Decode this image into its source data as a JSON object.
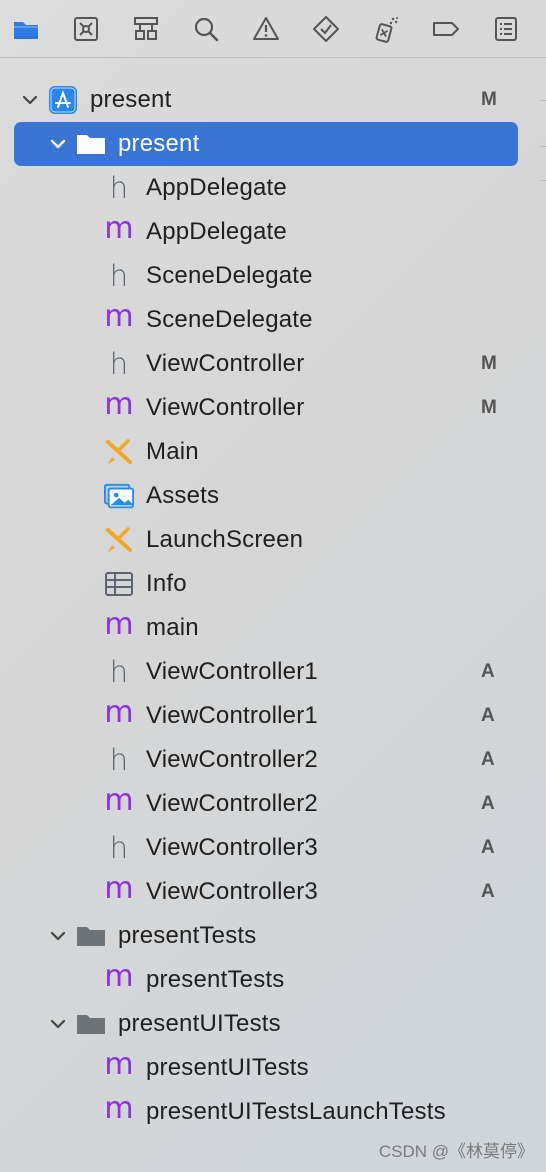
{
  "toolbar": {
    "icons": [
      "folder-icon",
      "source-control-icon",
      "hierarchy-icon",
      "search-icon",
      "warning-icon",
      "test-icon",
      "debug-icon",
      "breakpoint-icon",
      "report-icon"
    ]
  },
  "project": {
    "name": "present",
    "badge": "M"
  },
  "group_main": {
    "name": "present"
  },
  "files": [
    {
      "name": "AppDelegate",
      "kind": "h",
      "badge": ""
    },
    {
      "name": "AppDelegate",
      "kind": "m",
      "badge": ""
    },
    {
      "name": "SceneDelegate",
      "kind": "h",
      "badge": ""
    },
    {
      "name": "SceneDelegate",
      "kind": "m",
      "badge": ""
    },
    {
      "name": "ViewController",
      "kind": "h",
      "badge": "M"
    },
    {
      "name": "ViewController",
      "kind": "m",
      "badge": "M"
    },
    {
      "name": "Main",
      "kind": "storyboard",
      "badge": ""
    },
    {
      "name": "Assets",
      "kind": "assets",
      "badge": ""
    },
    {
      "name": "LaunchScreen",
      "kind": "storyboard",
      "badge": ""
    },
    {
      "name": "Info",
      "kind": "plist",
      "badge": ""
    },
    {
      "name": "main",
      "kind": "m",
      "badge": ""
    },
    {
      "name": "ViewController1",
      "kind": "h",
      "badge": "A"
    },
    {
      "name": "ViewController1",
      "kind": "m",
      "badge": "A"
    },
    {
      "name": "ViewController2",
      "kind": "h",
      "badge": "A"
    },
    {
      "name": "ViewController2",
      "kind": "m",
      "badge": "A"
    },
    {
      "name": "ViewController3",
      "kind": "h",
      "badge": "A"
    },
    {
      "name": "ViewController3",
      "kind": "m",
      "badge": "A"
    }
  ],
  "group_tests": {
    "name": "presentTests",
    "files": [
      {
        "name": "presentTests",
        "kind": "m"
      }
    ]
  },
  "group_uitests": {
    "name": "presentUITests",
    "files": [
      {
        "name": "presentUITests",
        "kind": "m"
      },
      {
        "name": "presentUITestsLaunchTests",
        "kind": "m"
      }
    ]
  },
  "glyphs": {
    "h": "h",
    "m": "m"
  },
  "watermark": "CSDN @《林莫停》",
  "colors": {
    "selection": "#3a75d6",
    "m_file": "#8e2fe8",
    "h_file": "#5b6470",
    "storyboard": "#f0a824",
    "assets": "#2a8ae6"
  }
}
